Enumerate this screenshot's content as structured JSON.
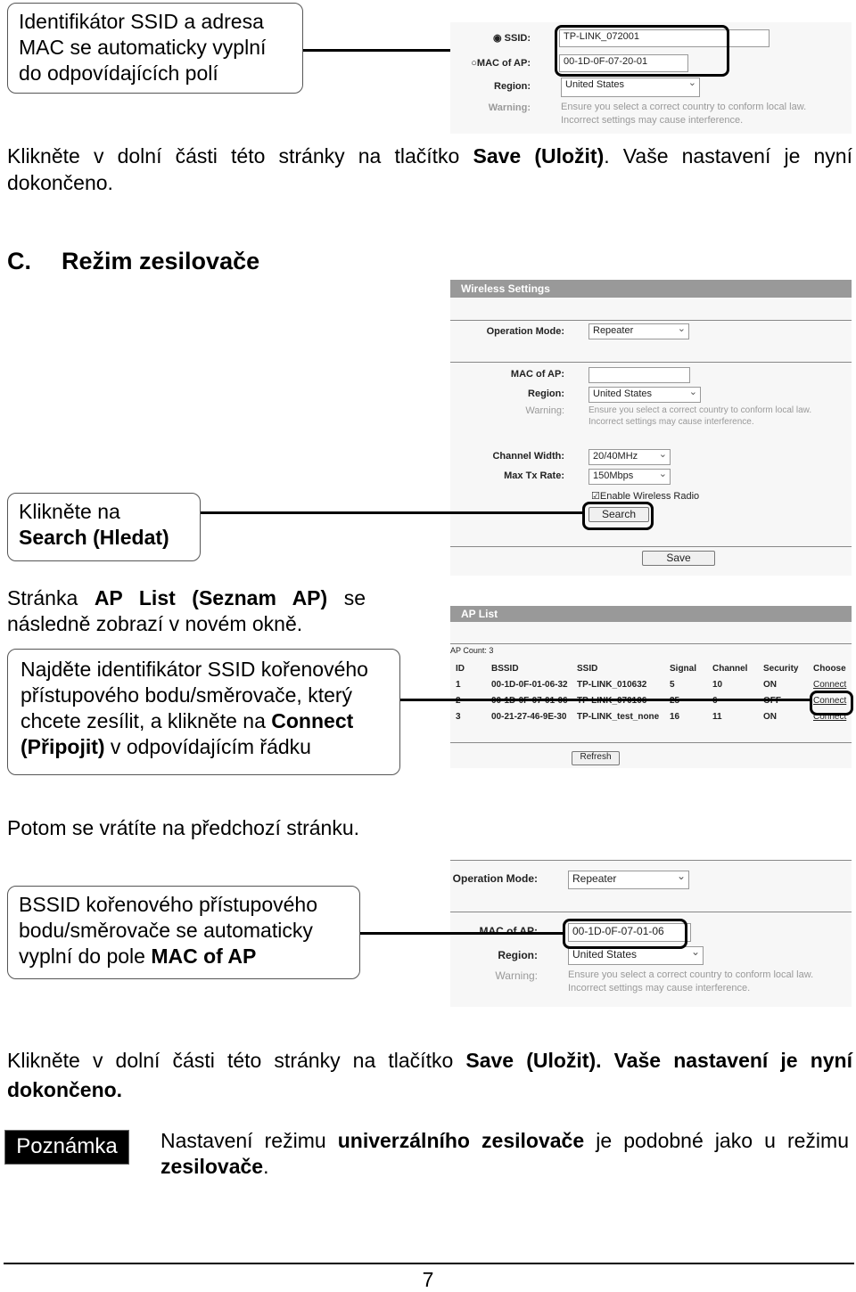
{
  "callouts": {
    "c1": "Identifikátor SSID a adresa MAC se automaticky vyplní do odpovídajících polí",
    "c2_a": "Klikněte na",
    "c2_b": "Search (Hledat)",
    "c3_a": "Najděte identifikátor SSID kořenového přístupového bodu/směrovače, který chcete zesílit, a klikněte na ",
    "c3_b": "Connect (Připojit)",
    "c3_c": " v odpovídajícím řádku",
    "c4_a": "BSSID kořenového přístupového bodu/směrovače se automaticky vyplní do pole ",
    "c4_b": "MAC of AP"
  },
  "text": {
    "p1_a": "Klikněte v dolní části této stránky na tlačítko ",
    "p1_b": "Save (Uložit)",
    "p1_c": ". Vaše nastavení je nyní dokončeno.",
    "heading_num": "C.",
    "heading": "Režim zesilovače",
    "p2_a": "Stránka ",
    "p2_b": "AP List (Seznam AP)",
    "p2_c": " se následně zobrazí v novém okně.",
    "p3": "Potom se vrátíte na předchozí stránku.",
    "p4_a": "Klikněte v dolní části této stránky na tlačítko ",
    "p4_b": "Save (Uložit)",
    "p4_c": ". Vaše nastavení je nyní dokončeno.",
    "note_label": "Poznámka",
    "note_a": "Nastavení režimu ",
    "note_b": "univerzálního zesilovače",
    "note_c": " je podobné jako u režimu ",
    "note_d": "zesilovače",
    "note_e": ".",
    "page_number": "7"
  },
  "shot1": {
    "ssid_label": "SSID:",
    "ssid": "TP-LINK_072001",
    "mac_label": "MAC of AP:",
    "mac": "00-1D-0F-07-20-01",
    "region_label": "Region:",
    "region": "United States",
    "warning_label": "Warning:",
    "warning1": "Ensure you select a correct country to conform local law.",
    "warning2": "Incorrect settings may cause interference."
  },
  "shot2": {
    "title": "Wireless Settings",
    "mode_label": "Operation Mode:",
    "mode": "Repeater",
    "mac_label": "MAC of AP:",
    "mac": "",
    "region_label": "Region:",
    "region": "United States",
    "warning_label": "Warning:",
    "warning1": "Ensure you select a correct country to conform local law.",
    "warning2": "Incorrect settings may cause interference.",
    "cw_label": "Channel Width:",
    "cw": "20/40MHz",
    "rate_label": "Max Tx Rate:",
    "rate": "150Mbps",
    "radio": "Enable Wireless Radio",
    "search": "Search",
    "save": "Save"
  },
  "shot3": {
    "title": "AP List",
    "count": "AP Count: 3",
    "headers": [
      "ID",
      "BSSID",
      "SSID",
      "Signal",
      "Channel",
      "Security",
      "Choose"
    ],
    "rows": [
      [
        "1",
        "00-1D-0F-01-06-32",
        "TP-LINK_010632",
        "5",
        "10",
        "ON",
        "Connect"
      ],
      [
        "2",
        "00-1D-0F-07-01-06",
        "TP-LINK_070106",
        "25",
        "6",
        "OFF",
        "Connect"
      ],
      [
        "3",
        "00-21-27-46-9E-30",
        "TP-LINK_test_none",
        "16",
        "11",
        "ON",
        "Connect"
      ]
    ],
    "refresh": "Refresh"
  },
  "shot4": {
    "mode_label": "Operation Mode:",
    "mode": "Repeater",
    "mac_label": "MAC of AP:",
    "mac": "00-1D-0F-07-01-06",
    "region_label": "Region:",
    "region": "United States",
    "warning_label": "Warning:",
    "warning1": "Ensure you select a correct country to conform local law.",
    "warning2": "Incorrect settings may cause interference."
  }
}
